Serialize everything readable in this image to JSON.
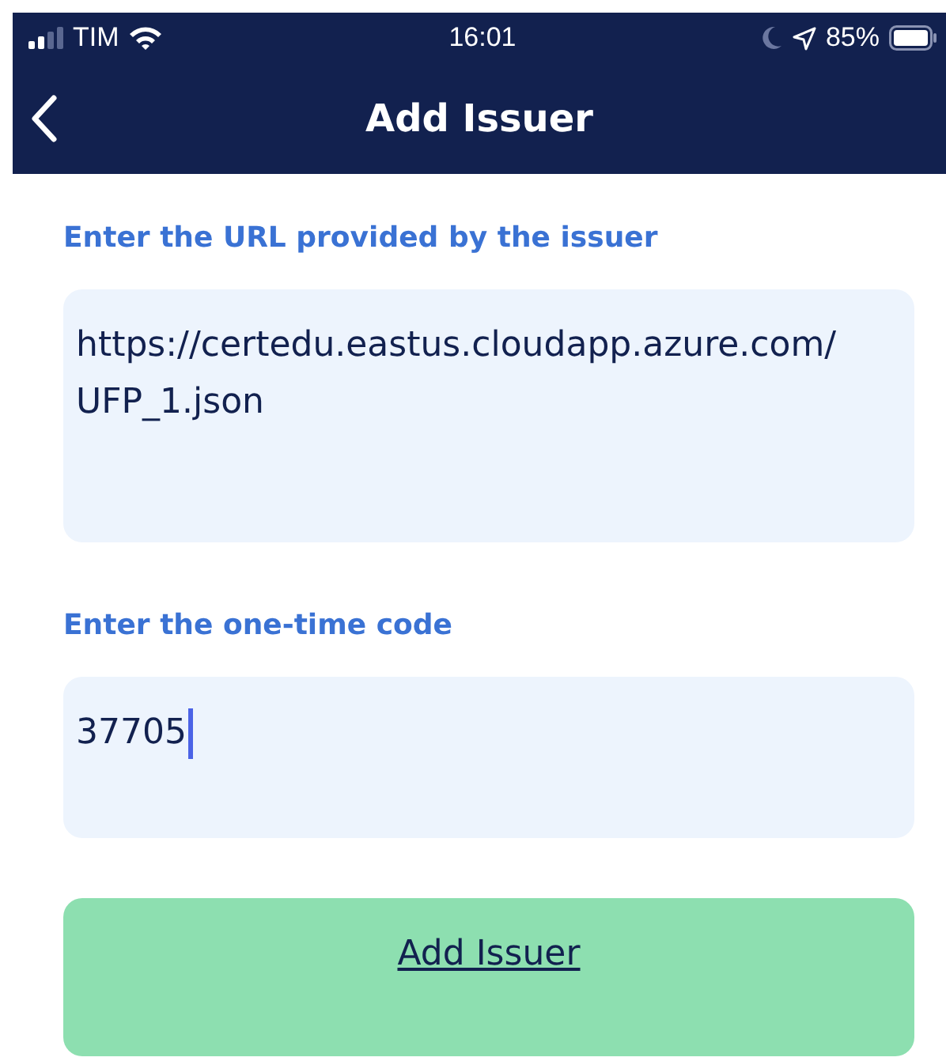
{
  "status_bar": {
    "carrier": "TIM",
    "time": "16:01",
    "battery": "85%"
  },
  "nav_bar": {
    "title": "Add Issuer"
  },
  "fields": [
    {
      "label": "Enter the URL provided by the issuer",
      "value": "https://certedu.eastus.cloudapp.azure.com/UFP_1.json",
      "focused": false,
      "kind": "tall"
    },
    {
      "label": "Enter the one-time code",
      "value": "37705",
      "focused": true,
      "kind": "short"
    }
  ],
  "button": {
    "label": "Add Issuer"
  }
}
